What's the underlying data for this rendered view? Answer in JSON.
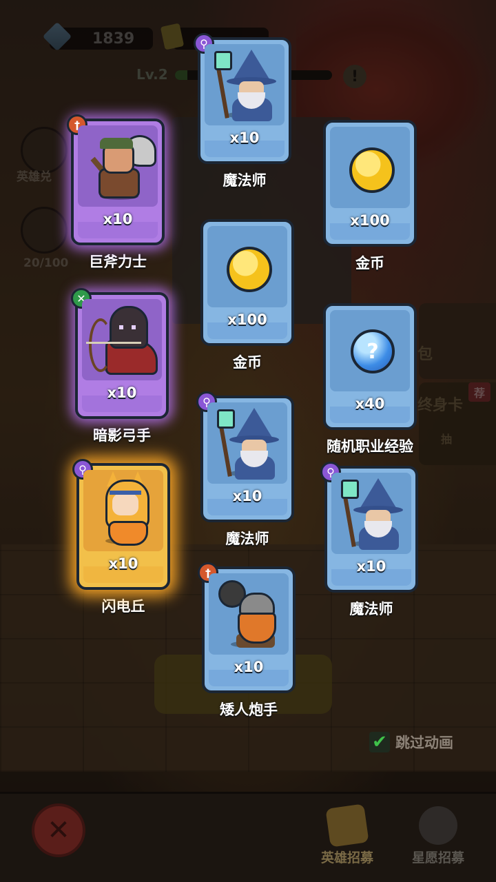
{
  "currency": {
    "gems": "1839"
  },
  "player": {
    "level": "Lv.2",
    "level_progress": 0.08
  },
  "side_menu": {
    "hero_exchange": "英雄兑",
    "progress_text": "20/100"
  },
  "right_panel": {
    "pack_text": "包",
    "lifetime_card": "终身卡",
    "recommend_badge": "荐",
    "sub_text": "抽"
  },
  "rewards": [
    {
      "name": "魔法师",
      "count": "x10",
      "rarity": "blue",
      "class_icon": "mage-staff-icon"
    },
    {
      "name": "金币",
      "count": "x100",
      "rarity": "blue",
      "class_icon": ""
    },
    {
      "name": "巨斧力士",
      "count": "x10",
      "rarity": "purple",
      "class_icon": "warrior-icon"
    },
    {
      "name": "金币",
      "count": "x100",
      "rarity": "blue",
      "class_icon": ""
    },
    {
      "name": "暗影弓手",
      "count": "x10",
      "rarity": "purple",
      "class_icon": "ranger-icon"
    },
    {
      "name": "随机职业经验",
      "count": "x40",
      "rarity": "blue",
      "class_icon": ""
    },
    {
      "name": "魔法师",
      "count": "x10",
      "rarity": "blue",
      "class_icon": "mage-staff-icon"
    },
    {
      "name": "闪电丘",
      "count": "x10",
      "rarity": "gold",
      "class_icon": "mage-staff-icon"
    },
    {
      "name": "魔法师",
      "count": "x10",
      "rarity": "blue",
      "class_icon": "mage-staff-icon"
    },
    {
      "name": "矮人炮手",
      "count": "x10",
      "rarity": "blue",
      "class_icon": "warrior-icon"
    }
  ],
  "skip_animation": {
    "label": "跳过动画",
    "checked": true,
    "check_glyph": "✔"
  },
  "bottom_nav": {
    "close_glyph": "✕",
    "hero_recruit": "英雄招募",
    "wish_recruit": "星愿招募"
  },
  "colors": {
    "blue_card": "#86b6e2",
    "purple_card": "#b07de4",
    "gold_card": "#f2c04a",
    "check_green": "#3fc24a"
  }
}
